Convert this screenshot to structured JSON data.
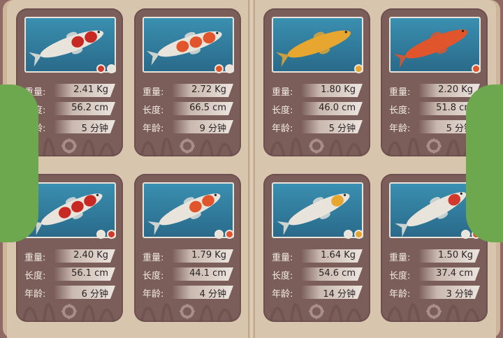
{
  "labels": {
    "weight": "重量:",
    "length": "长度:",
    "age": "年龄:"
  },
  "cards": [
    {
      "weight": "2.41 Kg",
      "length": "56.2 cm",
      "age": "5 分钟",
      "dots": [
        "#d0392b",
        "#e8e4dc"
      ],
      "fish": "kohaku"
    },
    {
      "weight": "2.72 Kg",
      "length": "66.5 cm",
      "age": "9 分钟",
      "dots": [
        "#e0552b",
        "#e8e4dc"
      ],
      "fish": "orange-white"
    },
    {
      "weight": "1.80 Kg",
      "length": "46.0 cm",
      "age": "5 分钟",
      "dots": [
        "#e6a630"
      ],
      "fish": "yellow"
    },
    {
      "weight": "2.20 Kg",
      "length": "51.8 cm",
      "age": "5 分钟",
      "dots": [
        "#e0552b"
      ],
      "fish": "orange"
    },
    {
      "weight": "2.40 Kg",
      "length": "56.1 cm",
      "age": "6 分钟",
      "dots": [
        "#e8e4dc",
        "#d0392b"
      ],
      "fish": "kohaku-white"
    },
    {
      "weight": "1.79 Kg",
      "length": "44.1 cm",
      "age": "4 分钟",
      "dots": [
        "#e8e4dc",
        "#e0552b"
      ],
      "fish": "white-orange"
    },
    {
      "weight": "1.64 Kg",
      "length": "54.6 cm",
      "age": "14 分钟",
      "dots": [
        "#e8e4dc",
        "#e6a630"
      ],
      "fish": "white-yellow"
    },
    {
      "weight": "1.50 Kg",
      "length": "37.4 cm",
      "age": "3 分钟",
      "dots": [
        "#e8e4dc",
        "#e0552b"
      ],
      "fish": "white-red"
    }
  ],
  "colors": {
    "tab": "#6ea84e",
    "card": "#7b5d5a",
    "page": "#d8c5ad"
  }
}
